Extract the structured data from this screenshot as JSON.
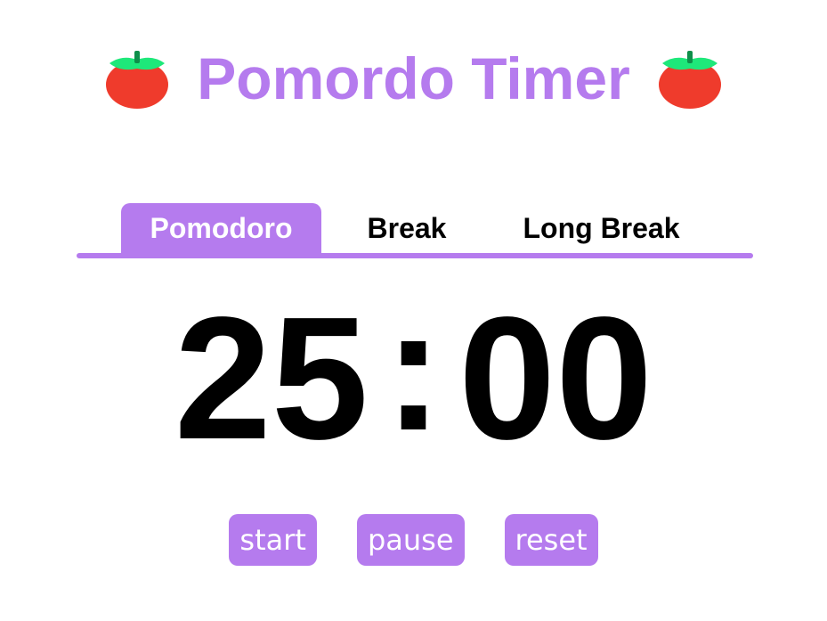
{
  "header": {
    "title": "Pomordo Timer",
    "left_icon": "tomato-icon",
    "right_icon": "tomato-icon"
  },
  "tabs": [
    {
      "label": "Pomodoro",
      "active": true
    },
    {
      "label": "Break",
      "active": false
    },
    {
      "label": "Long Break",
      "active": false
    }
  ],
  "timer": {
    "minutes": "25",
    "separator": ":",
    "seconds": "00"
  },
  "controls": {
    "start_label": "start",
    "pause_label": "pause",
    "reset_label": "reset"
  },
  "colors": {
    "accent": "#b57bee",
    "tomato_red": "#ef3b2c",
    "leaf_green": "#1ee87a",
    "text": "#000000"
  }
}
